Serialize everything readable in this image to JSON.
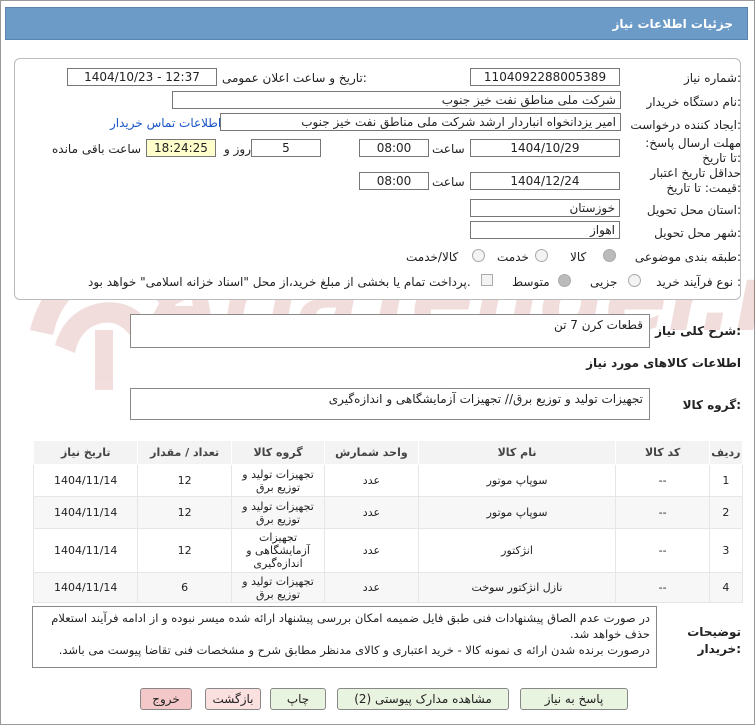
{
  "header": {
    "title": "جزئیات اطلاعات نیاز"
  },
  "info": {
    "need_number_label": "شماره نیاز:",
    "need_number": "1104092288005389",
    "announce_label": "تاریخ و ساعت اعلان عمومی:",
    "announce_value": "1404/10/23 - 12:37",
    "buyer_org_label": "نام دستگاه خریدار:",
    "buyer_org": "شرکت ملی مناطق نفت خیز جنوب",
    "creator_label": "ایجاد کننده درخواست:",
    "creator": "امیر یزدانخواه انباردار ارشد شرکت ملی مناطق نفت خیز جنوب",
    "contact_link": "اطلاعات تماس خریدار",
    "reply_deadline_label": "مهلت ارسال پاسخ: تا تاریخ:",
    "reply_date": "1404/10/29",
    "time_label": "ساعت",
    "reply_time": "08:00",
    "days_value": "5",
    "days_label": "روز و",
    "remaining_time": "18:24:25",
    "remaining_label": "ساعت باقی مانده",
    "validity_label": "حداقل تاریخ اعتبار قیمت: تا تاریخ:",
    "validity_date": "1404/12/24",
    "validity_time": "08:00",
    "province_label": "استان محل تحویل:",
    "province": "خوزستان",
    "city_label": "شهر محل تحویل:",
    "city": "اهواز",
    "category_label": "طبقه بندی موضوعی:",
    "category_options": [
      "کالا",
      "خدمت",
      "کالا/خدمت"
    ],
    "process_label": "نوع فرآیند خرید :",
    "process_options": [
      "جزیی",
      "متوسط"
    ],
    "treasury_note": "پرداخت تمام یا بخشی از مبلغ خرید،از محل \"اسناد خزانه اسلامی\" خواهد بود."
  },
  "summary": {
    "label": "شرح کلی نیاز:",
    "value": "قطعات کرن 7 تن",
    "goods_info_title": "اطلاعات کالاهای مورد نیاز",
    "group_label": "گروه کالا:",
    "group_value": "تجهیزات تولید و توزیع برق// تجهیزات آزمایشگاهی و اندازه‌گیری"
  },
  "table": {
    "headers": [
      "ردیف",
      "کد کالا",
      "نام کالا",
      "واحد شمارش",
      "گروه کالا",
      "تعداد / مقدار",
      "تاریخ نیاز"
    ],
    "rows": [
      [
        "1",
        "--",
        "سوپاپ موتور",
        "عدد",
        "تجهیزات تولید و توزیع برق",
        "12",
        "1404/11/14"
      ],
      [
        "2",
        "--",
        "سوپاپ موتور",
        "عدد",
        "تجهیزات تولید و توزیع برق",
        "12",
        "1404/11/14"
      ],
      [
        "3",
        "--",
        "انژکتور",
        "عدد",
        "تجهیزات آزمایشگاهی و اندازه‌گیری",
        "12",
        "1404/11/14"
      ],
      [
        "4",
        "--",
        "نازل انژکتور سوخت",
        "عدد",
        "تجهیزات تولید و توزیع برق",
        "6",
        "1404/11/14"
      ]
    ]
  },
  "notes": {
    "label": "توضیحات خریدار:",
    "line1": "در صورت عدم الصاق پیشنهادات فنی طبق فایل ضمیمه امکان بررسی پیشنهاد ارائه شده میسر نبوده و از ادامه فرآیند استعلام حذف خواهد شد.",
    "line2": "درصورت برنده شدن ارائه ی نمونه کالا - خرید اعتباری و کالای مدنظر مطابق شرح و مشخصات فنی تقاضا پیوست می باشد."
  },
  "buttons": {
    "reply": "پاسخ به نیاز",
    "attachments": "مشاهده مدارک پیوستی (2)",
    "print": "چاپ",
    "back": "بازگشت",
    "exit": "خروج"
  },
  "watermark": "AriaTender.net"
}
